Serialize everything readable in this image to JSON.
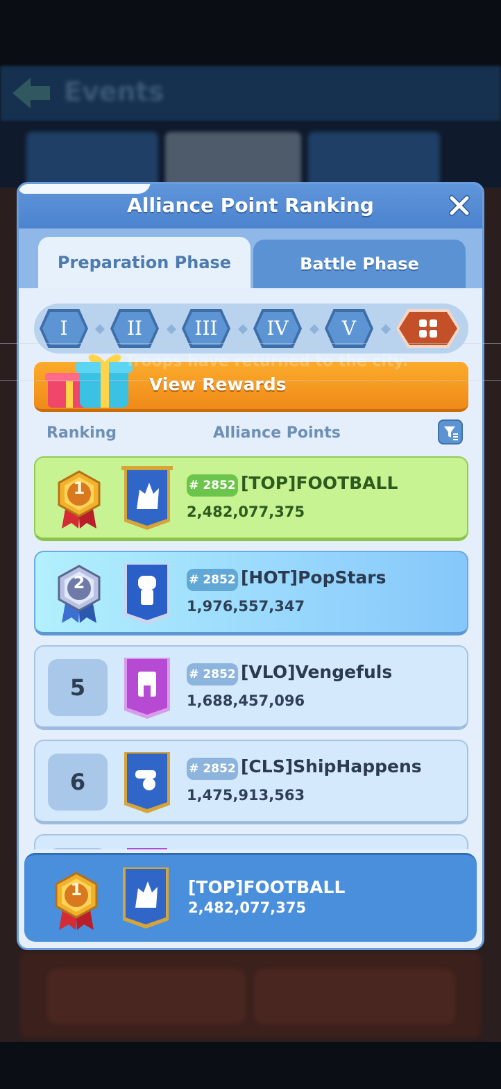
{
  "background": {
    "title": "Events"
  },
  "toast": {
    "text": "Troops have returned to the city."
  },
  "dialog": {
    "title": "Alliance Point Ranking",
    "close_icon": "close-icon"
  },
  "tabs": [
    {
      "label": "Preparation Phase",
      "active": true
    },
    {
      "label": "Battle Phase",
      "active": false
    }
  ],
  "stages": [
    {
      "label": "I"
    },
    {
      "label": "II"
    },
    {
      "label": "III"
    },
    {
      "label": "IV"
    },
    {
      "label": "V"
    },
    {
      "icon": "grid-icon",
      "active": true
    }
  ],
  "rewards": {
    "label": "View Rewards",
    "icon": "gift-icon"
  },
  "columns": {
    "ranking": "Ranking",
    "points": "Alliance Points",
    "filter_icon": "filter-icon"
  },
  "rows": [
    {
      "rank": "1",
      "style": "gold-medal",
      "server": "# 2852",
      "name": "[TOP]FOOTBALL",
      "points": "2,482,077,375",
      "emblem": "wolf-icon",
      "banner_color": "#2f66c8"
    },
    {
      "rank": "2",
      "style": "silver-medal",
      "server": "# 2852",
      "name": "[HOT]PopStars",
      "points": "1,976,557,347",
      "emblem": "gauntlet-icon",
      "banner_color": "#2f66c8"
    },
    {
      "rank": "5",
      "style": "plain",
      "server": "# 2852",
      "name": "[VLO]Vengefuls",
      "points": "1,688,457,096",
      "emblem": "tower-icon",
      "banner_color": "#b64ad3"
    },
    {
      "rank": "6",
      "style": "plain",
      "server": "# 2852",
      "name": "[CLS]ShipHappens",
      "points": "1,475,913,563",
      "emblem": "cannon-icon",
      "banner_color": "#2f66c8"
    }
  ],
  "my_alliance": {
    "rank": "1",
    "name": "[TOP]FOOTBALL",
    "points": "2,482,077,375",
    "emblem": "wolf-icon"
  }
}
